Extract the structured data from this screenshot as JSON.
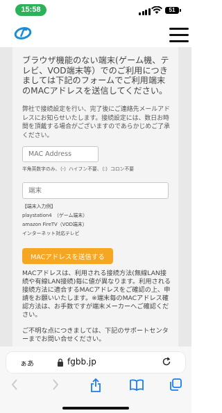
{
  "status_bar": {
    "time": "15:58",
    "battery": "51",
    "time_pill_color": "#2cb35a"
  },
  "header": {
    "logo_icon": "fgbb-logo-icon",
    "menu_icon": "hamburger-icon"
  },
  "form": {
    "intro": "ブラウザ機能のない端末(ゲーム機、テレビ、VOD端末等）でのご利用につきましては下記のフォームでご利用端末のMACアドレスを送信してください。",
    "note": "弊社で接続設定を行い、完了後にご連絡先メールアドレスにお知らせいたします。接続設定には、数日お時間を頂戴する場合がございますのであらかじめご了承ください。",
    "mac_placeholder": "MAC Address",
    "mac_hint": "半角英数字のみ、（-）ハイフン不要、（:）コロン不要",
    "device_placeholder": "端末",
    "examples_title": "【端末入力例】",
    "examples": [
      "playstation4　（ゲーム端末）",
      "amazon FireTV（VOD端末）",
      "インターネット対応テレビ"
    ],
    "send_button": "MACアドレスを送信する",
    "send_button_color": "#f5a623",
    "explain": "MACアドレスは、利用される接続方法(無線LAN接続や有線LAN接続)毎に値が異なります。利用される接続方法に適合するMACアドレスをご確認の上、申請をお願いいたします。※端末毎のMACアドレス確認方法は、お手数ですが端末メーカーへご確認ください。",
    "contact": "ご不明な点につきましては、下記のサポートセンターまでお問い合せください。"
  },
  "browser": {
    "aa_label": "ぁあ",
    "url": "fgbb.jp",
    "icons": [
      "lock-icon",
      "reload-icon",
      "back-icon",
      "forward-icon",
      "share-icon",
      "bookmarks-icon",
      "tabs-icon"
    ]
  }
}
